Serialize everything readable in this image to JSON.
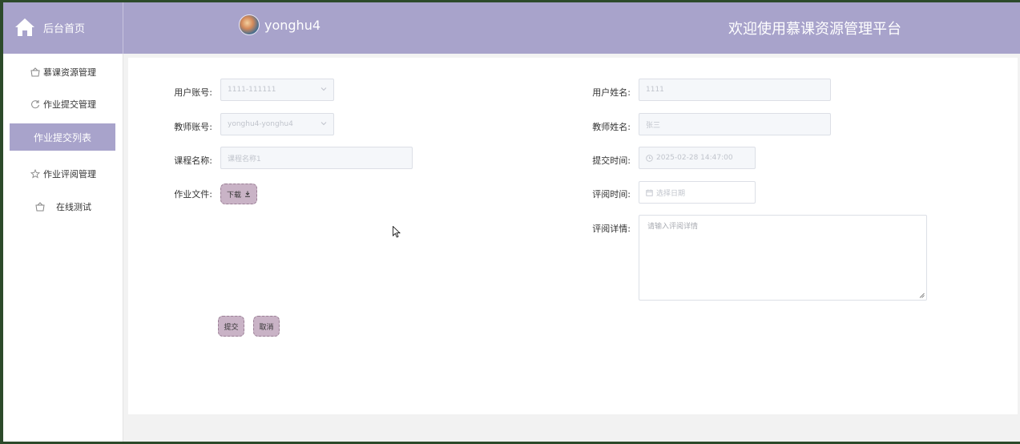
{
  "header": {
    "home_label": "后台首页",
    "username": "yonghu4",
    "welcome": "欢迎使用慕课资源管理平台",
    "bg_color": "#a8a3cb"
  },
  "sidebar": {
    "items": [
      {
        "label": "慕课资源管理",
        "icon": "basket-icon"
      },
      {
        "label": "作业提交管理",
        "icon": "refresh-icon"
      },
      {
        "label": "作业提交列表",
        "active": true
      },
      {
        "label": "作业评阅管理",
        "icon": "star-icon"
      },
      {
        "label": "在线测试",
        "icon": "basket-icon"
      }
    ]
  },
  "form": {
    "user_account": {
      "label": "用户账号:",
      "value": "1111-111111"
    },
    "teacher_account": {
      "label": "教师账号:",
      "value": "yonghu4-yonghu4"
    },
    "course_name": {
      "label": "课程名称:",
      "value": "课程名称1"
    },
    "homework_file": {
      "label": "作业文件:",
      "button": "下载"
    },
    "user_name": {
      "label": "用户姓名:",
      "value": "1111"
    },
    "teacher_name": {
      "label": "教师姓名:",
      "value": "张三"
    },
    "submit_time": {
      "label": "提交时间:",
      "value": "2025-02-28 14:47:00"
    },
    "review_time": {
      "label": "评阅时间:",
      "placeholder": "选择日期"
    },
    "review_detail": {
      "label": "评阅详情:",
      "placeholder": "请输入评阅详情"
    },
    "submit_button": "提交",
    "cancel_button": "取消"
  }
}
